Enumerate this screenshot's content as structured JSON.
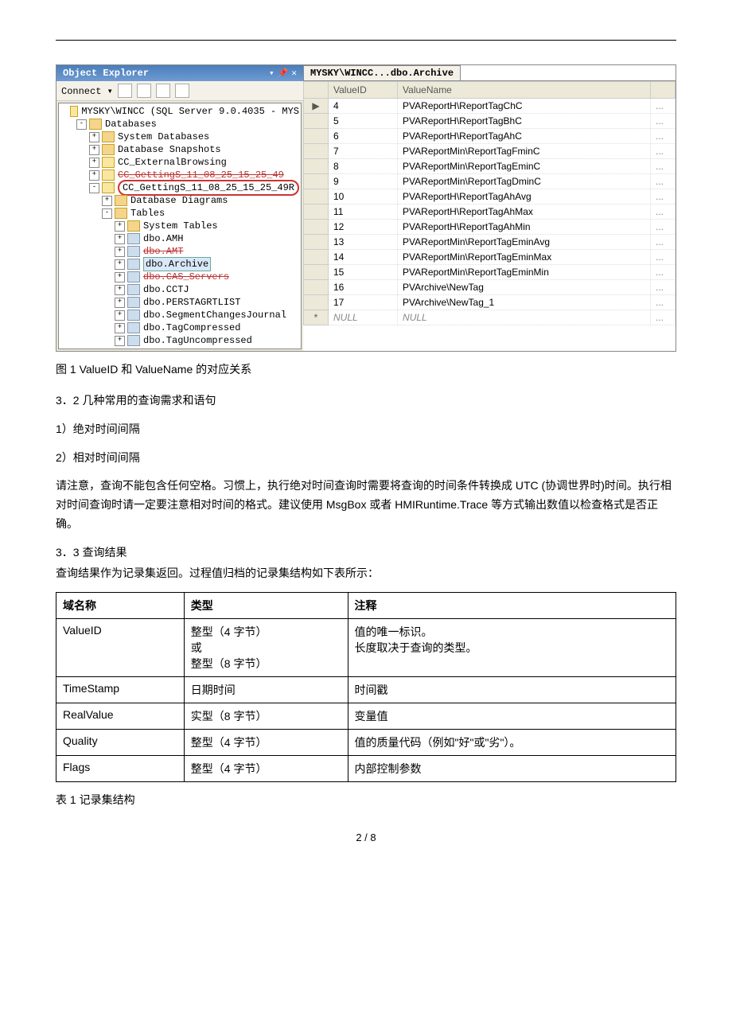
{
  "objExplorer": {
    "title": "Object Explorer",
    "connectLabel": "Connect ▾",
    "tree": [
      {
        "lvl": 1,
        "tgl": "",
        "ico": "db",
        "text": "MYSKY\\WINCC (SQL Server 9.0.4035 - MYS",
        "sel": false
      },
      {
        "lvl": 2,
        "tgl": "-",
        "ico": "folder",
        "text": "Databases"
      },
      {
        "lvl": 3,
        "tgl": "+",
        "ico": "folder",
        "text": "System Databases"
      },
      {
        "lvl": 3,
        "tgl": "+",
        "ico": "folder",
        "text": "Database Snapshots"
      },
      {
        "lvl": 3,
        "tgl": "+",
        "ico": "db",
        "text": "CC_ExternalBrowsing"
      },
      {
        "lvl": 3,
        "tgl": "+",
        "ico": "db",
        "text": "CC_GettingS_11_08_25_15_25_49",
        "strike": true
      },
      {
        "lvl": 3,
        "tgl": "-",
        "ico": "db",
        "text": "CC_GettingS_11_08_25_15_25_49R",
        "circled": true
      },
      {
        "lvl": 4,
        "tgl": "+",
        "ico": "folder",
        "text": "Database Diagrams"
      },
      {
        "lvl": 4,
        "tgl": "-",
        "ico": "folder",
        "text": "Tables"
      },
      {
        "lvl": 5,
        "tgl": "+",
        "ico": "folder",
        "text": "System Tables"
      },
      {
        "lvl": 5,
        "tgl": "+",
        "ico": "tbl",
        "text": "dbo.AMH"
      },
      {
        "lvl": 5,
        "tgl": "+",
        "ico": "tbl",
        "text": "dbo.AMT",
        "strike": true
      },
      {
        "lvl": 5,
        "tgl": "+",
        "ico": "tbl",
        "text": "dbo.Archive",
        "sel": true
      },
      {
        "lvl": 5,
        "tgl": "+",
        "ico": "tbl",
        "text": "dbo.CAS_Servers",
        "strike": true
      },
      {
        "lvl": 5,
        "tgl": "+",
        "ico": "tbl",
        "text": "dbo.CCTJ"
      },
      {
        "lvl": 5,
        "tgl": "+",
        "ico": "tbl",
        "text": "dbo.PERSTAGRTLIST"
      },
      {
        "lvl": 5,
        "tgl": "+",
        "ico": "tbl",
        "text": "dbo.SegmentChangesJournal"
      },
      {
        "lvl": 5,
        "tgl": "+",
        "ico": "tbl",
        "text": "dbo.TagCompressed"
      },
      {
        "lvl": 5,
        "tgl": "+",
        "ico": "tbl",
        "text": "dbo.TagUncompressed"
      }
    ]
  },
  "dataPane": {
    "tabLabel": "MYSKY\\WINCC...dbo.Archive",
    "headers": [
      "ValueID",
      "ValueName"
    ],
    "rows": [
      {
        "mark": "▶",
        "id": "4",
        "name": "PVAReportH\\ReportTagChC"
      },
      {
        "mark": "",
        "id": "5",
        "name": "PVAReportH\\ReportTagBhC"
      },
      {
        "mark": "",
        "id": "6",
        "name": "PVAReportH\\ReportTagAhC"
      },
      {
        "mark": "",
        "id": "7",
        "name": "PVAReportMin\\ReportTagFminC"
      },
      {
        "mark": "",
        "id": "8",
        "name": "PVAReportMin\\ReportTagEminC"
      },
      {
        "mark": "",
        "id": "9",
        "name": "PVAReportMin\\ReportTagDminC"
      },
      {
        "mark": "",
        "id": "10",
        "name": "PVAReportH\\ReportTagAhAvg"
      },
      {
        "mark": "",
        "id": "11",
        "name": "PVAReportH\\ReportTagAhMax"
      },
      {
        "mark": "",
        "id": "12",
        "name": "PVAReportH\\ReportTagAhMin"
      },
      {
        "mark": "",
        "id": "13",
        "name": "PVAReportMin\\ReportTagEminAvg"
      },
      {
        "mark": "",
        "id": "14",
        "name": "PVAReportMin\\ReportTagEminMax"
      },
      {
        "mark": "",
        "id": "15",
        "name": "PVAReportMin\\ReportTagEminMin"
      },
      {
        "mark": "",
        "id": "16",
        "name": "PVArchive\\NewTag"
      },
      {
        "mark": "",
        "id": "17",
        "name": "PVArchive\\NewTag_1"
      },
      {
        "mark": "*",
        "id": "NULL",
        "name": "NULL",
        "null": true
      }
    ]
  },
  "body": {
    "fig1": "图 1 ValueID 和 ValueName 的对应关系",
    "sec32": "3．2 几种常用的查询需求和语句",
    "item1": "1）绝对时间间隔",
    "item2": "2）相对时间间隔",
    "para1": "请注意，查询不能包含任何空格。习惯上，执行绝对时间查询时需要将查询的时间条件转换成 UTC (协调世界时)时间。执行相对时间查询时请一定要注意相对时间的格式。建议使用 MsgBox 或者 HMIRuntime.Trace 等方式输出数值以检查格式是否正确。",
    "sec33": "3．3 查询结果",
    "para2": "查询结果作为记录集返回。过程值归档的记录集结构如下表所示：",
    "tableHeaders": [
      "域名称",
      "类型",
      "注释"
    ],
    "tableRows": [
      {
        "c1": "ValueID",
        "c2": "整型（4 字节）\n或\n整型（8 字节）",
        "c3": "值的唯一标识。\n长度取决于查询的类型。"
      },
      {
        "c1": "TimeStamp",
        "c2": "日期时间",
        "c3": "时间戳"
      },
      {
        "c1": "RealValue",
        "c2": "实型（8 字节）",
        "c3": "变量值"
      },
      {
        "c1": "Quality",
        "c2": "整型（4 字节）",
        "c3": "值的质量代码（例如\"好\"或\"劣\"）。"
      },
      {
        "c1": "Flags",
        "c2": "整型（4 字节）",
        "c3": "内部控制参数"
      }
    ],
    "tableCaption": "表 1 记录集结构",
    "pageNum": "2 / 8"
  }
}
